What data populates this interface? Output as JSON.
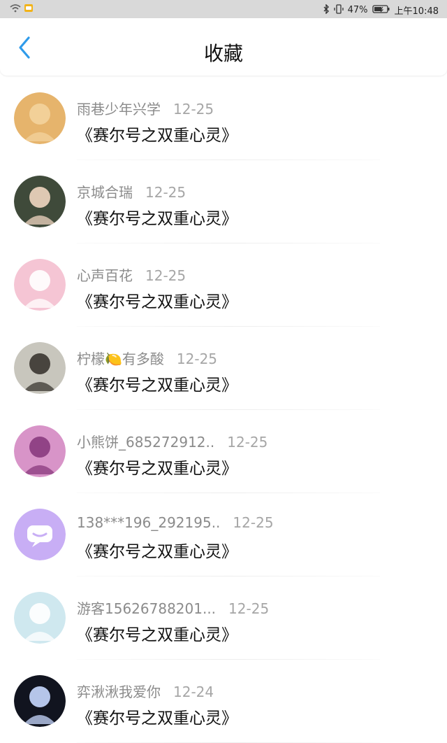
{
  "status_bar": {
    "battery_text": "47%",
    "time_text": "上午10:48"
  },
  "header": {
    "title": "收藏"
  },
  "favorites": [
    {
      "name": "雨巷少年兴学",
      "date": "12-25",
      "book": "《赛尔号之双重心灵》",
      "avatar_color": "#e6b46c",
      "avatar_accent": "#f3d39d"
    },
    {
      "name": "京城合瑞",
      "date": "12-25",
      "book": "《赛尔号之双重心灵》",
      "avatar_color": "#3f4a3a",
      "avatar_accent": "#f0d6c1"
    },
    {
      "name": "心声百花",
      "date": "12-25",
      "book": "《赛尔号之双重心灵》",
      "avatar_color": "#f5c5d4",
      "avatar_accent": "#ffffff"
    },
    {
      "name": "柠檬🍋有多酸",
      "date": "12-25",
      "book": "《赛尔号之双重心灵》",
      "avatar_color": "#c8c6bd",
      "avatar_accent": "#3a3530"
    },
    {
      "name": "小熊饼_685272912..",
      "date": "12-25",
      "book": "《赛尔号之双重心灵》",
      "avatar_color": "#d894c8",
      "avatar_accent": "#8a3a7e"
    },
    {
      "name": "138***196_292195..",
      "date": "12-25",
      "book": "《赛尔号之双重心灵》",
      "avatar_color": "#c8aef5",
      "avatar_accent": "#ffffff"
    },
    {
      "name": "游客15626788201...",
      "date": "12-25",
      "book": "《赛尔号之双重心灵》",
      "avatar_color": "#cfe8ef",
      "avatar_accent": "#ffffff"
    },
    {
      "name": "弈湫湫我爱你",
      "date": "12-24",
      "book": "《赛尔号之双重心灵》",
      "avatar_color": "#11141f",
      "avatar_accent": "#c8d8ff"
    }
  ],
  "colors": {
    "accent_blue": "#2f9bea",
    "meta_gray": "#8b8b8b",
    "status_bar_bg": "#d9d9d9"
  },
  "icons": {
    "back": "chevron-left-icon",
    "wifi": "wifi-icon",
    "sim": "sim-icon",
    "bluetooth": "bluetooth-icon",
    "vibrate": "vibrate-icon",
    "battery": "battery-icon"
  }
}
